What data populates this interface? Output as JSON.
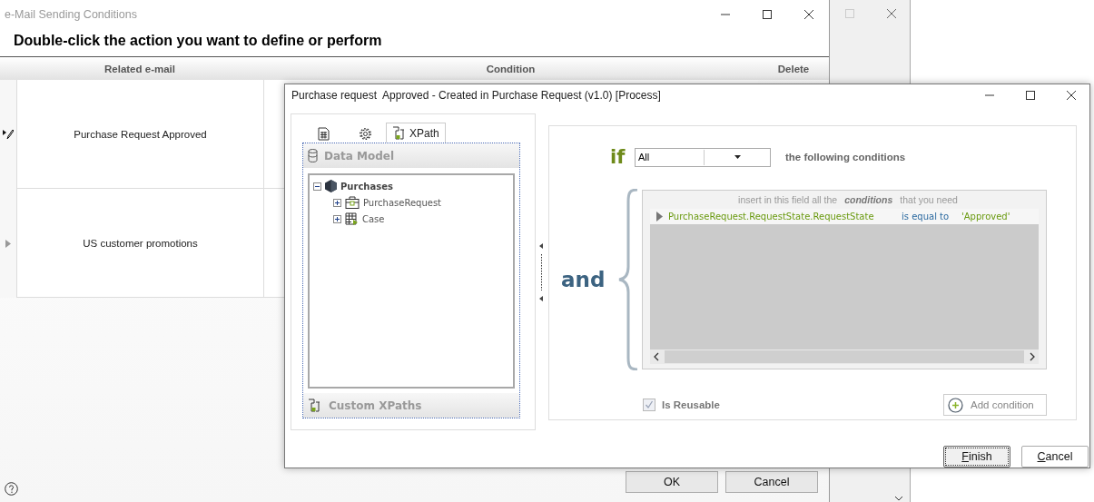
{
  "main_window": {
    "title": "e-Mail Sending Conditions",
    "heading": "Double-click the action you want to define or perform",
    "table": {
      "columns": [
        "Related e-mail",
        "Condition",
        "Delete"
      ],
      "rows": [
        {
          "related_email": "Purchase Request Approved",
          "editing": true
        },
        {
          "related_email": "US customer promotions",
          "editing": false
        }
      ]
    },
    "buttons": [
      "OK",
      "Cancel"
    ]
  },
  "dialog": {
    "title": "Purchase request  Approved - Created in Purchase Request (v1.0) [Process]",
    "tabs": [
      {
        "kind": "form",
        "selected": false
      },
      {
        "kind": "settings",
        "selected": false
      },
      {
        "kind": "xpath",
        "label": "XPath",
        "selected": true
      }
    ],
    "data_model": {
      "title": "Data Model",
      "tree": [
        {
          "label": "Purchases",
          "kind": "entity",
          "expanded": true,
          "children": [
            {
              "label": "PurchaseRequest",
              "kind": "folder",
              "expanded": false
            },
            {
              "label": "Case",
              "kind": "table",
              "expanded": false
            }
          ]
        }
      ]
    },
    "custom_xpaths": {
      "title": "Custom XPaths"
    },
    "conditions": {
      "if_label": "if",
      "quantifier": "All",
      "following": "the following conditions",
      "and_label": "and",
      "hint": "insert in this field all the **conditions** that you need",
      "rows": [
        {
          "field": "PurchaseRequest.RequestState.RequestState",
          "operator": "is equal to",
          "value": "'Approved'"
        }
      ],
      "is_reusable": {
        "label": "Is Reusable",
        "checked": true
      },
      "add_button": "Add condition"
    },
    "buttons": [
      {
        "label": "Finish",
        "default": true
      },
      {
        "label": "Cancel",
        "default": false
      }
    ]
  }
}
